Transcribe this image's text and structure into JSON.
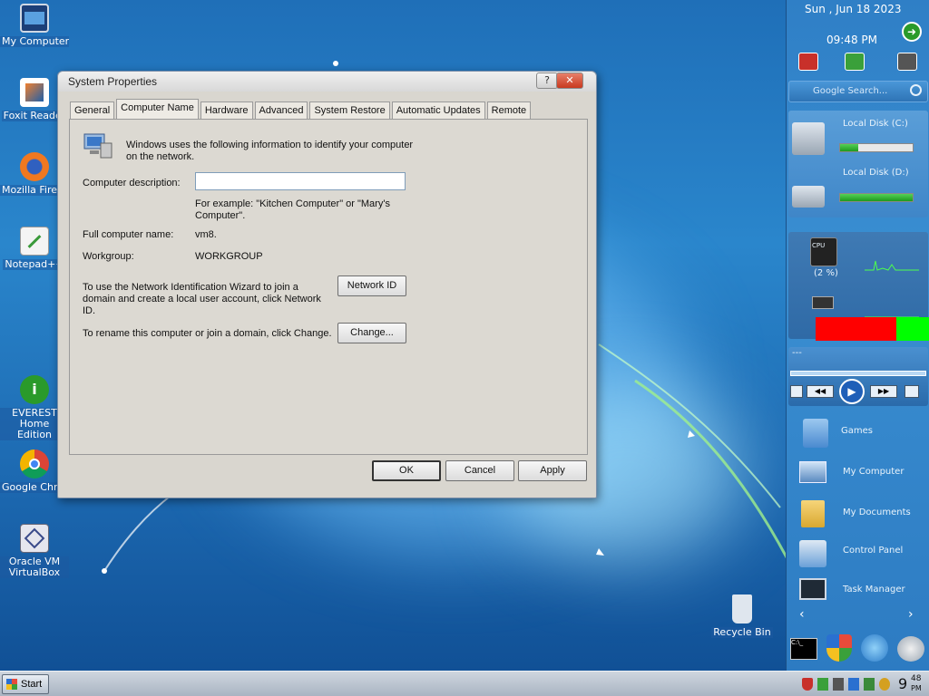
{
  "desktop_icons": [
    {
      "label": "My Computer"
    },
    {
      "label": "Foxit Reader"
    },
    {
      "label": "Mozilla Firefox"
    },
    {
      "label": "Notepad++"
    },
    {
      "label": "EVEREST Home Edition"
    },
    {
      "label": "Google Chrome"
    },
    {
      "label": "Oracle VM VirtualBox"
    },
    {
      "label": "Recycle Bin"
    }
  ],
  "dialog": {
    "title": "System Properties",
    "help_label": "?",
    "close_label": "✕",
    "tabs": [
      "General",
      "Computer Name",
      "Hardware",
      "Advanced",
      "System Restore",
      "Automatic Updates",
      "Remote"
    ],
    "intro_line1": "Windows uses the following information to identify your computer",
    "intro_line2": "on the network.",
    "description_label": "Computer description:",
    "description_value": "",
    "example_line1": "For example: \"Kitchen Computer\" or \"Mary's",
    "example_line2": "Computer\".",
    "full_name_label": "Full computer name:",
    "full_name_value": "vm8.",
    "workgroup_label": "Workgroup:",
    "workgroup_value": "WORKGROUP",
    "netid_text1": "To use the Network Identification Wizard to join a",
    "netid_text2": "domain and create a local user account, click Network",
    "netid_text3": "ID.",
    "netid_button": "Network ID",
    "rename_text": "To rename this computer or join a domain, click Change.",
    "change_button": "Change...",
    "ok_button": "OK",
    "cancel_button": "Cancel",
    "apply_button": "Apply"
  },
  "sidebar": {
    "date": "Sun , Jun 18 2023",
    "time": "09:48 PM",
    "search_placeholder": "Google Search...",
    "disk_c_label": "Local Disk (C:)",
    "disk_c_usage": 0.25,
    "disk_d_label": "Local Disk (D:)",
    "disk_d_usage": 1.0,
    "cpu_label": "CPU",
    "cpu_percent": "(2 %)",
    "media_title": "---",
    "launcher": [
      "Games",
      "My Computer",
      "My Documents",
      "Control Panel",
      "Task Manager"
    ]
  },
  "taskbar": {
    "start_label": "Start",
    "clock_hour": "9",
    "clock_min": "48",
    "clock_ampm": "PM"
  },
  "colors": {
    "wallpaper": "#1f6fb8",
    "dialog_bg": "#d9d6cf",
    "close_red": "#c8391f",
    "sidebar": "#3a8fd2",
    "disk_green": "#2fb52f",
    "ram_red": "#ff0000",
    "ram_green": "#00ff00"
  }
}
